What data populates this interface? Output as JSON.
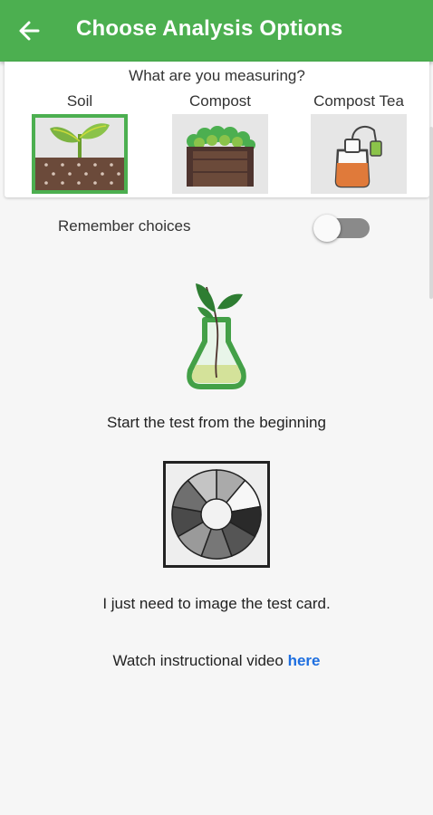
{
  "appbar": {
    "title": "Choose Analysis Options",
    "back_icon": "arrow-left-icon",
    "color": "#4caf50"
  },
  "measure": {
    "question": "What are you measuring?",
    "options": [
      {
        "label": "Soil",
        "icon": "soil-seedling-icon",
        "selected": true
      },
      {
        "label": "Compost",
        "icon": "compost-crate-icon",
        "selected": false
      },
      {
        "label": "Compost Tea",
        "icon": "tea-bag-cup-icon",
        "selected": false
      }
    ]
  },
  "remember": {
    "label": "Remember choices",
    "enabled": false
  },
  "start": {
    "label": "Start the test from the beginning",
    "icon": "plant-flask-icon"
  },
  "image_card": {
    "label": "I just need to image the test card.",
    "icon": "color-wheel-card-icon"
  },
  "video": {
    "prefix": "Watch instructional video ",
    "link": "here",
    "link_color": "#1e6fe0"
  }
}
